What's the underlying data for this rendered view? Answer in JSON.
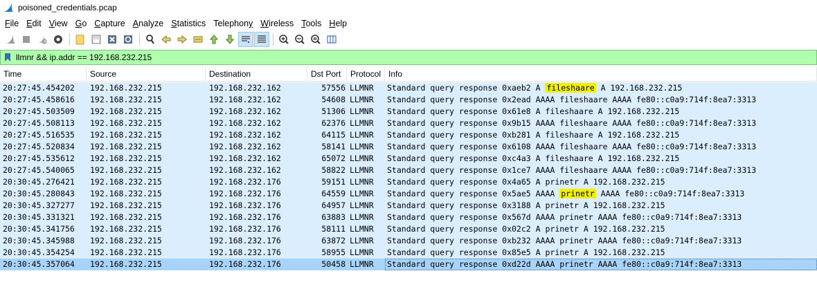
{
  "window": {
    "title": "poisoned_credentials.pcap"
  },
  "menu": [
    {
      "pre": "",
      "u": "F",
      "post": "ile"
    },
    {
      "pre": "",
      "u": "E",
      "post": "dit"
    },
    {
      "pre": "",
      "u": "V",
      "post": "iew"
    },
    {
      "pre": "",
      "u": "G",
      "post": "o"
    },
    {
      "pre": "",
      "u": "C",
      "post": "apture"
    },
    {
      "pre": "",
      "u": "A",
      "post": "nalyze"
    },
    {
      "pre": "",
      "u": "S",
      "post": "tatistics"
    },
    {
      "pre": "Telephon",
      "u": "y",
      "post": ""
    },
    {
      "pre": "",
      "u": "W",
      "post": "ireless"
    },
    {
      "pre": "",
      "u": "T",
      "post": "ools"
    },
    {
      "pre": "",
      "u": "H",
      "post": "elp"
    }
  ],
  "filter": {
    "value": "llmnr && ip.addr == 192.168.232.215"
  },
  "columns": {
    "time": "Time",
    "source": "Source",
    "destination": "Destination",
    "dst_port": "Dst Port",
    "protocol": "Protocol",
    "info": "Info"
  },
  "packets": [
    {
      "time": "20:27:45.454202",
      "src": "192.168.232.215",
      "dst": "192.168.232.162",
      "dport": "57556",
      "proto": "LLMNR",
      "info_pre": "Standard query response 0xaeb2 A ",
      "info_hl": "fileshaare",
      "info_post": " A 192.168.232.215",
      "selected": false
    },
    {
      "time": "20:27:45.458616",
      "src": "192.168.232.215",
      "dst": "192.168.232.162",
      "dport": "54608",
      "proto": "LLMNR",
      "info_pre": "Standard query response 0x2ead AAAA fileshaare AAAA fe80::c0a9:714f:8ea7:3313",
      "info_hl": "",
      "info_post": "",
      "selected": false
    },
    {
      "time": "20:27:45.503509",
      "src": "192.168.232.215",
      "dst": "192.168.232.162",
      "dport": "51306",
      "proto": "LLMNR",
      "info_pre": "Standard query response 0x61e8 A fileshaare A 192.168.232.215",
      "info_hl": "",
      "info_post": "",
      "selected": false
    },
    {
      "time": "20:27:45.508113",
      "src": "192.168.232.215",
      "dst": "192.168.232.162",
      "dport": "62376",
      "proto": "LLMNR",
      "info_pre": "Standard query response 0x9b15 AAAA fileshaare AAAA fe80::c0a9:714f:8ea7:3313",
      "info_hl": "",
      "info_post": "",
      "selected": false
    },
    {
      "time": "20:27:45.516535",
      "src": "192.168.232.215",
      "dst": "192.168.232.162",
      "dport": "64115",
      "proto": "LLMNR",
      "info_pre": "Standard query response 0xb281 A fileshaare A 192.168.232.215",
      "info_hl": "",
      "info_post": "",
      "selected": false
    },
    {
      "time": "20:27:45.520834",
      "src": "192.168.232.215",
      "dst": "192.168.232.162",
      "dport": "58141",
      "proto": "LLMNR",
      "info_pre": "Standard query response 0x6108 AAAA fileshaare AAAA fe80::c0a9:714f:8ea7:3313",
      "info_hl": "",
      "info_post": "",
      "selected": false
    },
    {
      "time": "20:27:45.535612",
      "src": "192.168.232.215",
      "dst": "192.168.232.162",
      "dport": "65072",
      "proto": "LLMNR",
      "info_pre": "Standard query response 0xc4a3 A fileshaare A 192.168.232.215",
      "info_hl": "",
      "info_post": "",
      "selected": false
    },
    {
      "time": "20:27:45.540065",
      "src": "192.168.232.215",
      "dst": "192.168.232.162",
      "dport": "58822",
      "proto": "LLMNR",
      "info_pre": "Standard query response 0x1ce7 AAAA fileshaare AAAA fe80::c0a9:714f:8ea7:3313",
      "info_hl": "",
      "info_post": "",
      "selected": false
    },
    {
      "time": "20:30:45.276421",
      "src": "192.168.232.215",
      "dst": "192.168.232.176",
      "dport": "59151",
      "proto": "LLMNR",
      "info_pre": "Standard query response 0x4a65 A prinetr A 192.168.232.215",
      "info_hl": "",
      "info_post": "",
      "selected": false
    },
    {
      "time": "20:30:45.280843",
      "src": "192.168.232.215",
      "dst": "192.168.232.176",
      "dport": "64559",
      "proto": "LLMNR",
      "info_pre": "Standard query response 0x5ae5 AAAA ",
      "info_hl": "prinetr",
      "info_post": " AAAA fe80::c0a9:714f:8ea7:3313",
      "selected": false
    },
    {
      "time": "20:30:45.327277",
      "src": "192.168.232.215",
      "dst": "192.168.232.176",
      "dport": "64957",
      "proto": "LLMNR",
      "info_pre": "Standard query response 0x3188 A prinetr A 192.168.232.215",
      "info_hl": "",
      "info_post": "",
      "selected": false
    },
    {
      "time": "20:30:45.331321",
      "src": "192.168.232.215",
      "dst": "192.168.232.176",
      "dport": "63883",
      "proto": "LLMNR",
      "info_pre": "Standard query response 0x567d AAAA prinetr AAAA fe80::c0a9:714f:8ea7:3313",
      "info_hl": "",
      "info_post": "",
      "selected": false
    },
    {
      "time": "20:30:45.341756",
      "src": "192.168.232.215",
      "dst": "192.168.232.176",
      "dport": "58111",
      "proto": "LLMNR",
      "info_pre": "Standard query response 0x02c2 A prinetr A 192.168.232.215",
      "info_hl": "",
      "info_post": "",
      "selected": false
    },
    {
      "time": "20:30:45.345988",
      "src": "192.168.232.215",
      "dst": "192.168.232.176",
      "dport": "63872",
      "proto": "LLMNR",
      "info_pre": "Standard query response 0xb232 AAAA prinetr AAAA fe80::c0a9:714f:8ea7:3313",
      "info_hl": "",
      "info_post": "",
      "selected": false
    },
    {
      "time": "20:30:45.354254",
      "src": "192.168.232.215",
      "dst": "192.168.232.176",
      "dport": "58955",
      "proto": "LLMNR",
      "info_pre": "Standard query response 0x85e5 A prinetr A 192.168.232.215",
      "info_hl": "",
      "info_post": "",
      "selected": false
    },
    {
      "time": "20:30:45.357064",
      "src": "192.168.232.215",
      "dst": "192.168.232.176",
      "dport": "50458",
      "proto": "LLMNR",
      "info_pre": "Standard query response 0xd22d AAAA prinetr AAAA fe80::c0a9:714f:8ea7:3313",
      "info_hl": "",
      "info_post": "",
      "selected": true
    }
  ],
  "colors": {
    "row_bg": "#daeefe",
    "row_selected_bg": "#a8d4fb",
    "filter_bg": "#afffaf",
    "highlight": "#f0f000"
  }
}
